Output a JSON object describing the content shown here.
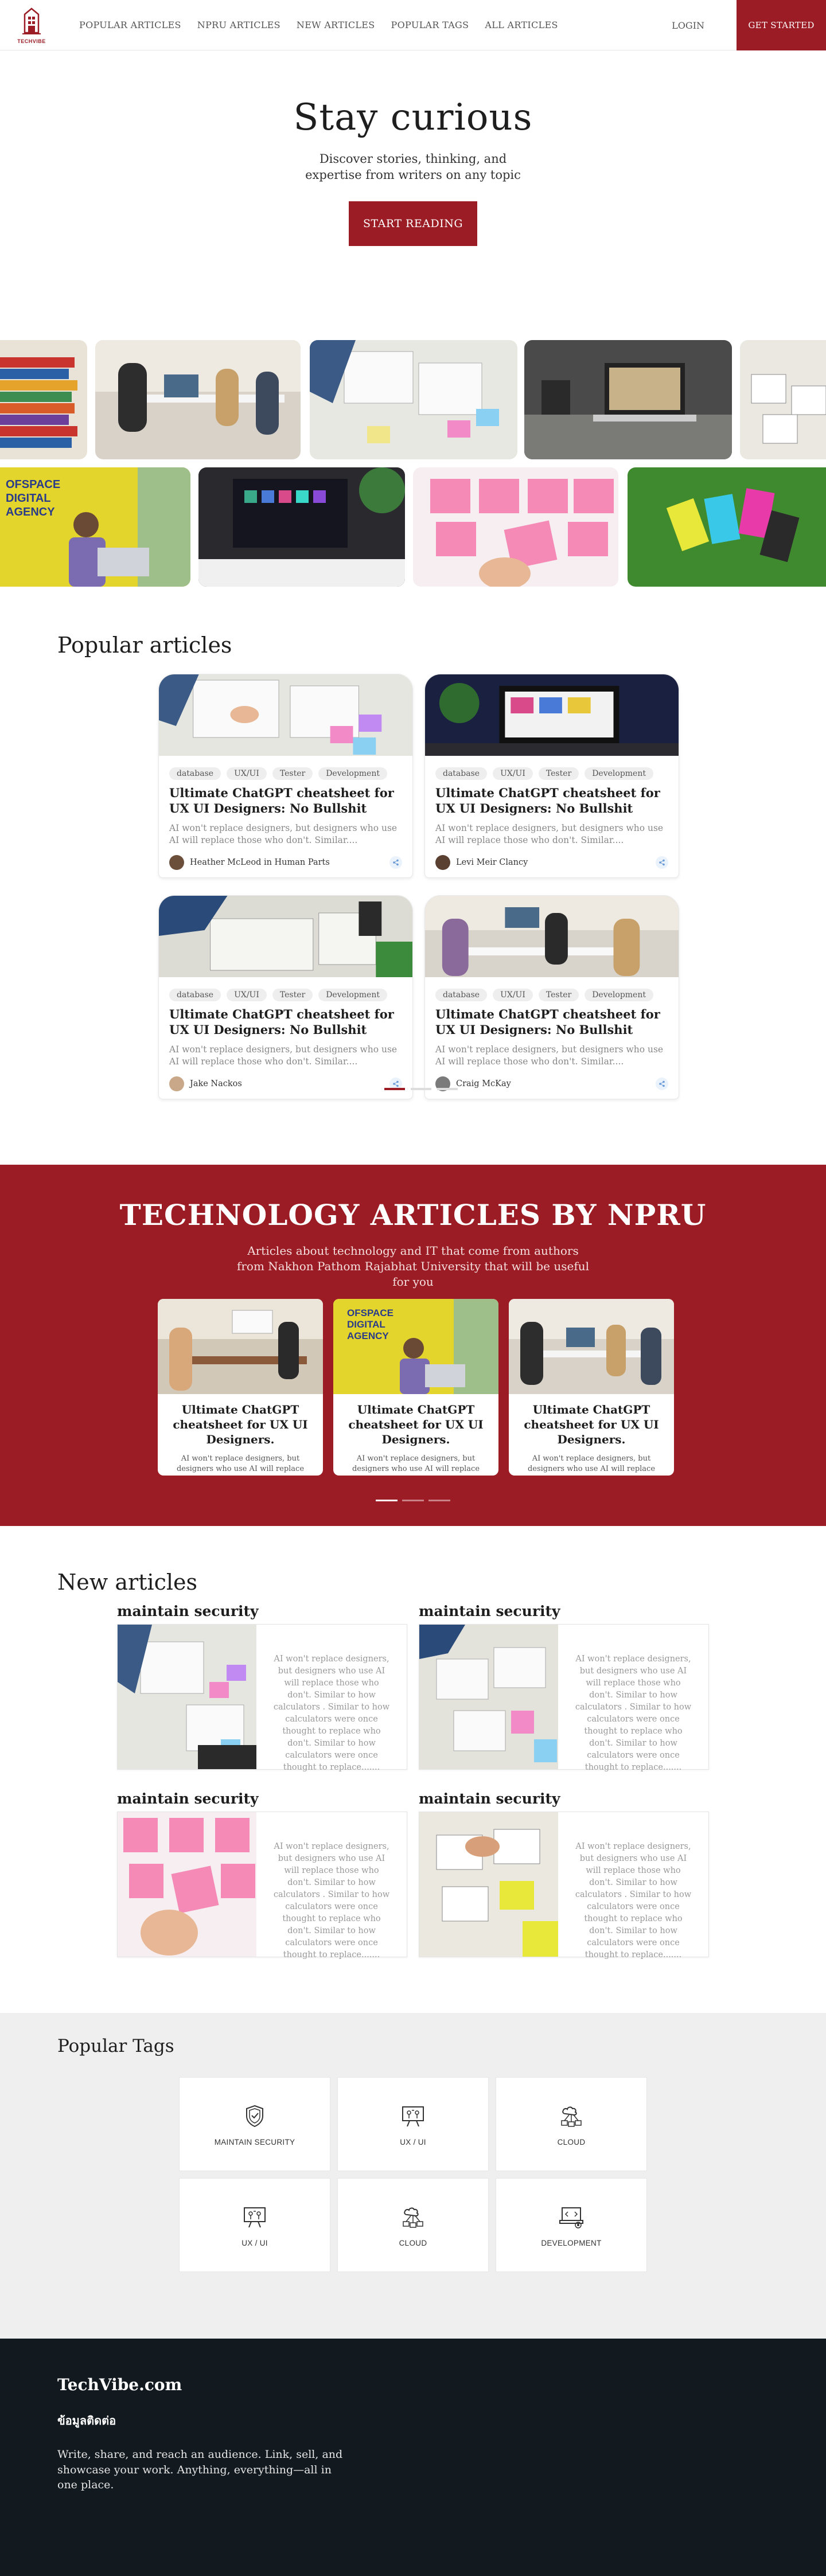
{
  "brand": {
    "logo_text": "TECHVIBE"
  },
  "nav": {
    "links": [
      "POPULAR ARTICLES",
      "NPRU ARTICLES",
      "NEW ARTICLES",
      "POPULAR TAGS",
      "ALL ARTICLES"
    ],
    "login": "LOGIN",
    "get_started": "GET STARTED"
  },
  "hero": {
    "title": "Stay curious",
    "subtitle": "Discover stories, thinking, and expertise from writers on any topic",
    "cta": "START READING"
  },
  "gallery": {
    "row1_text": "OFSPACE DIGITAL AGENCY"
  },
  "popular": {
    "title": "Popular articles",
    "cards": [
      {
        "tags": [
          "database",
          "UX/UI",
          "Tester",
          "Development"
        ],
        "title": "Ultimate ChatGPT cheatsheet for UX UI Designers: No Bullshit",
        "desc": "AI won't replace designers, but designers who use AI will replace those who don't. Similar....",
        "author": "Heather McLeod in Human Parts"
      },
      {
        "tags": [
          "database",
          "UX/UI",
          "Tester",
          "Development"
        ],
        "title": "Ultimate ChatGPT cheatsheet for UX UI Designers: No Bullshit",
        "desc": "AI won't replace designers, but designers who use AI will replace those who don't. Similar....",
        "author": "Levi Meir Clancy"
      },
      {
        "tags": [
          "database",
          "UX/UI",
          "Tester",
          "Development"
        ],
        "title": "Ultimate ChatGPT cheatsheet for UX UI Designers: No Bullshit",
        "desc": "AI won't replace designers, but designers who use AI will replace those who don't. Similar....",
        "author": "Jake Nackos"
      },
      {
        "tags": [
          "database",
          "UX/UI",
          "Tester",
          "Development"
        ],
        "title": "Ultimate ChatGPT cheatsheet for UX UI Designers: No Bullshit",
        "desc": "AI won't replace designers, but designers who use AI will replace those who don't. Similar....",
        "author": "Craig McKay"
      }
    ]
  },
  "npru": {
    "title": "TECHNOLOGY ARTICLES BY NPRU",
    "subtitle": "Articles about technology and IT that come from authors from Nakhon Pathom Rajabhat University that will be useful for you",
    "cards": [
      {
        "title": "Ultimate ChatGPT cheatsheet for UX UI Designers.",
        "desc": "AI won't replace designers, but designers who use AI will replace those who don't. Similar...."
      },
      {
        "title": "Ultimate ChatGPT cheatsheet for UX UI Designers.",
        "desc": "AI won't replace designers, but designers who use AI will replace those who don't. Similar...."
      },
      {
        "title": "Ultimate ChatGPT cheatsheet for UX UI Designers.",
        "desc": "AI won't replace designers, but designers who use AI will replace those who don't. Similar...."
      }
    ]
  },
  "new_articles": {
    "title": "New articles",
    "items": [
      {
        "title": "maintain security",
        "desc": "AI won't replace designers, but designers who use AI will replace those who don't. Similar to how calculators . Similar to how calculators were once thought to replace who don't. Similar to how calculators were once thought to replace......."
      },
      {
        "title": "maintain security",
        "desc": "AI won't replace designers, but designers who use AI will replace those who don't. Similar to how calculators . Similar to how calculators were once thought to replace who don't. Similar to how calculators were once thought to replace......."
      },
      {
        "title": "maintain security",
        "desc": "AI won't replace designers, but designers who use AI will replace those who don't. Similar to how calculators . Similar to how calculators were once thought to replace who don't. Similar to how calculators were once thought to replace......."
      },
      {
        "title": "maintain security",
        "desc": "AI won't replace designers, but designers who use AI will replace those who don't. Similar to how calculators . Similar to how calculators were once thought to replace who don't. Similar to how calculators were once thought to replace......."
      }
    ]
  },
  "popular_tags": {
    "title": "Popular Tags",
    "tags": [
      {
        "label": "MAINTAIN SECURITY",
        "icon": "shield-icon"
      },
      {
        "label": "UX / UI",
        "icon": "ux-ui-icon"
      },
      {
        "label": "CLOUD",
        "icon": "cloud-network-icon"
      },
      {
        "label": "UX / UI",
        "icon": "ux-ui-icon"
      },
      {
        "label": "CLOUD",
        "icon": "cloud-network-icon"
      },
      {
        "label": "DEVELOPMENT",
        "icon": "development-icon"
      }
    ]
  },
  "footer": {
    "title": "TechVibe.com",
    "subtitle": "ข้อมูลติดต่อ",
    "text": "Write, share, and reach an audience. Link, sell, and showcase your work. Anything, everything—all in one place."
  },
  "colors": {
    "brand": "#9b1c24",
    "footer_bg": "#121a20",
    "tags_bg": "#efefef"
  }
}
